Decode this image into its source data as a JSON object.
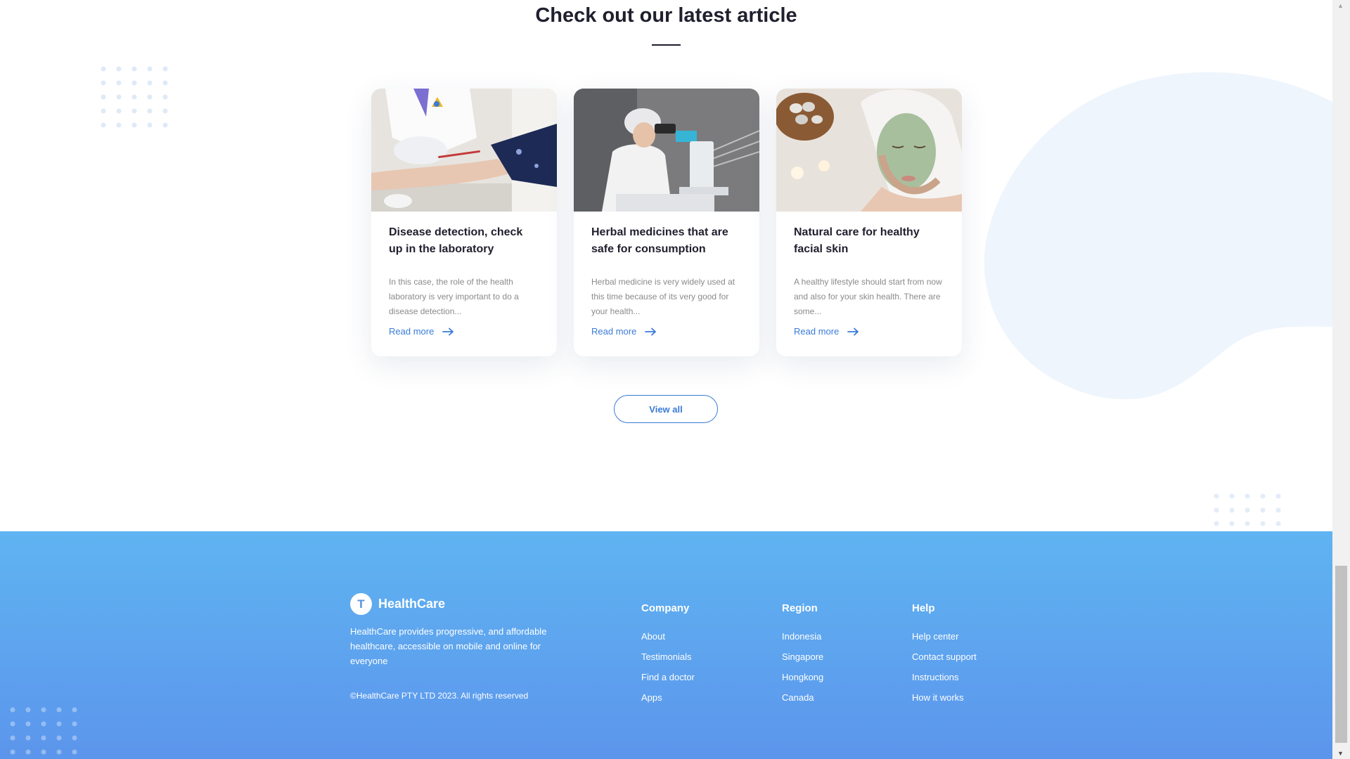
{
  "section": {
    "heading": "Check out our latest article"
  },
  "articles": [
    {
      "title": "Disease detection, check up in the laboratory",
      "excerpt": "In this case, the role of the health laboratory is very important to do a disease detection...",
      "link_label": "Read more",
      "image_icon": "lab-blood-test-photo"
    },
    {
      "title": "Herbal medicines that are safe for consumption",
      "excerpt": "Herbal medicine is very widely used at this time because of its very good for your health...",
      "link_label": "Read more",
      "image_icon": "microscope-researcher-photo"
    },
    {
      "title": "Natural care for healthy facial skin",
      "excerpt": "A healthy lifestyle should start from now and also for your skin health. There are some...",
      "link_label": "Read more",
      "image_icon": "facial-mask-spa-photo"
    }
  ],
  "view_all_label": "View all",
  "footer": {
    "brand": {
      "logo_letter": "T",
      "name": "HealthCare",
      "description": "HealthCare provides progressive, and affordable healthcare, accessible on mobile and online for everyone"
    },
    "copyright": "©HealthCare PTY LTD 2023. All rights reserved",
    "columns": [
      {
        "title": "Company",
        "links": [
          "About",
          "Testimonials",
          "Find a doctor",
          "Apps"
        ]
      },
      {
        "title": "Region",
        "links": [
          "Indonesia",
          "Singapore",
          "Hongkong",
          "Canada"
        ]
      },
      {
        "title": "Help",
        "links": [
          "Help center",
          "Contact support",
          "Instructions",
          "How it works"
        ]
      }
    ]
  },
  "colors": {
    "accent": "#3a7bd8",
    "heading": "#1f1f2e",
    "footer_top": "#5fb4f1",
    "footer_bottom": "#5c95ec",
    "dots": "#dfeaf8",
    "blob": "#eff5fd"
  }
}
